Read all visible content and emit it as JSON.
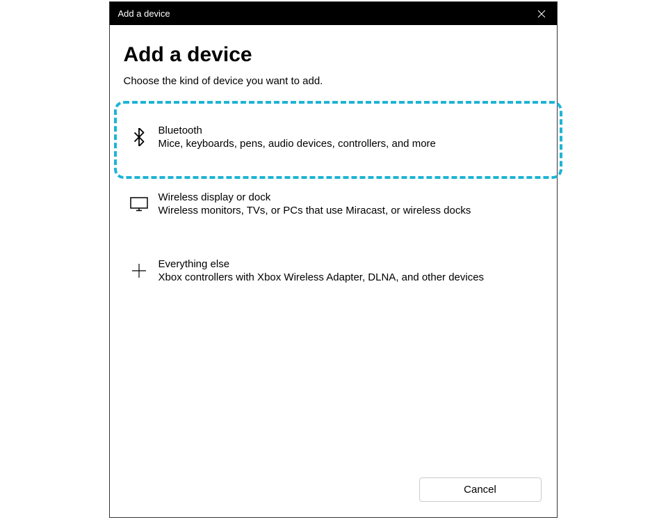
{
  "titlebar": {
    "title": "Add a device"
  },
  "heading": "Add a device",
  "subheading": "Choose the kind of device you want to add.",
  "options": [
    {
      "icon": "bluetooth",
      "title": "Bluetooth",
      "desc": "Mice, keyboards, pens, audio devices, controllers, and more",
      "highlighted": true
    },
    {
      "icon": "monitor",
      "title": "Wireless display or dock",
      "desc": "Wireless monitors, TVs, or PCs that use Miracast, or wireless docks",
      "highlighted": false
    },
    {
      "icon": "plus",
      "title": "Everything else",
      "desc": "Xbox controllers with Xbox Wireless Adapter, DLNA, and other devices",
      "highlighted": false
    }
  ],
  "footer": {
    "cancel_label": "Cancel"
  }
}
